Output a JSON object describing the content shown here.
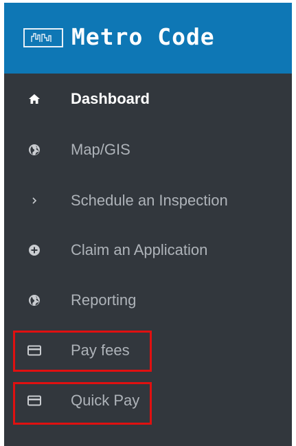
{
  "app": {
    "title": "Metro Code",
    "logo_icon": "skyline-logo-icon",
    "header_color": "#0e77b5",
    "sidebar_color": "#32373d"
  },
  "nav": {
    "items": [
      {
        "label": "Dashboard",
        "icon": "home-icon",
        "active": true
      },
      {
        "label": "Map/GIS",
        "icon": "globe-icon",
        "active": false
      },
      {
        "label": "Schedule an Inspection",
        "icon": "chevron-right-icon",
        "active": false
      },
      {
        "label": "Claim an Application",
        "icon": "plus-circle-icon",
        "active": false
      },
      {
        "label": "Reporting",
        "icon": "globe-icon",
        "active": false
      },
      {
        "label": "Pay fees",
        "icon": "credit-card-icon",
        "active": false,
        "highlighted": true
      },
      {
        "label": "Quick Pay",
        "icon": "credit-card-icon",
        "active": false,
        "highlighted": true
      }
    ]
  },
  "highlight_color": "#e01010"
}
